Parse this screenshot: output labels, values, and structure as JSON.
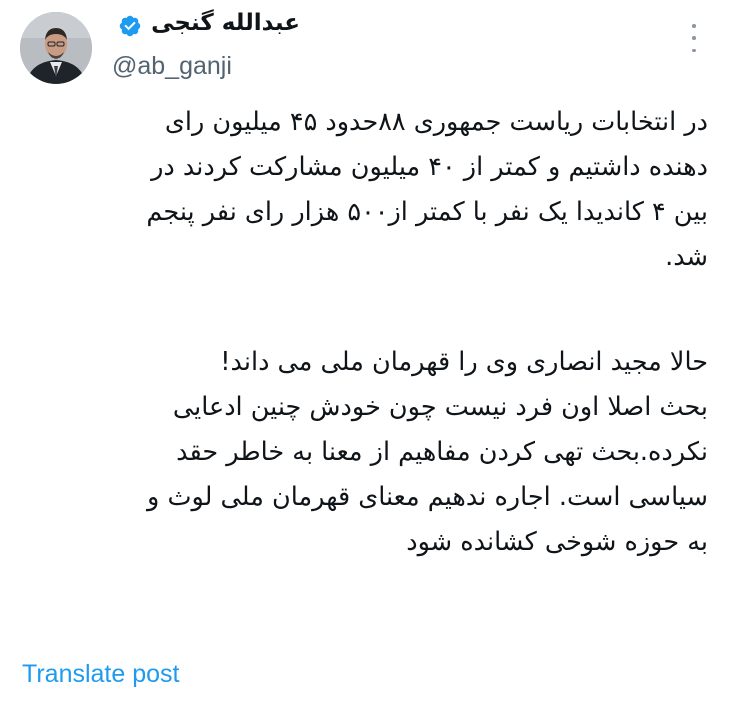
{
  "author": {
    "display_name": "عبدالله گنجی",
    "handle": "@ab_ganji",
    "verified": true,
    "verified_color": "#1d9bf0"
  },
  "post": {
    "lines": [
      "در انتخابات ریاست جمهوری ۸۸حدود ۴۵ میلیون رای",
      "دهنده داشتیم و کمتر از ۴۰ میلیون مشارکت کردند در",
      "بین ۴ کاندیدا یک نفر با کمتر از۵۰۰ هزار رای نفر پنجم",
      "شد.",
      "حالا مجید انصاری وی را قهرمان ملی می داند!",
      "بحث اصلا اون فرد نیست چون خودش چنین ادعایی",
      "نکرده.بحث تهی کردن مفاهیم از معنا به خاطر حقد",
      "سیاسی است. اجاره ندهیم معنای قهرمان ملی لوث و",
      "به حوزه شوخی کشانده شود"
    ]
  },
  "actions": {
    "translate_label": "Translate post",
    "more_icon": "more-vertical-icon"
  },
  "colors": {
    "text": "#0f1419",
    "secondary": "#536471",
    "link": "#1d9bf0"
  }
}
